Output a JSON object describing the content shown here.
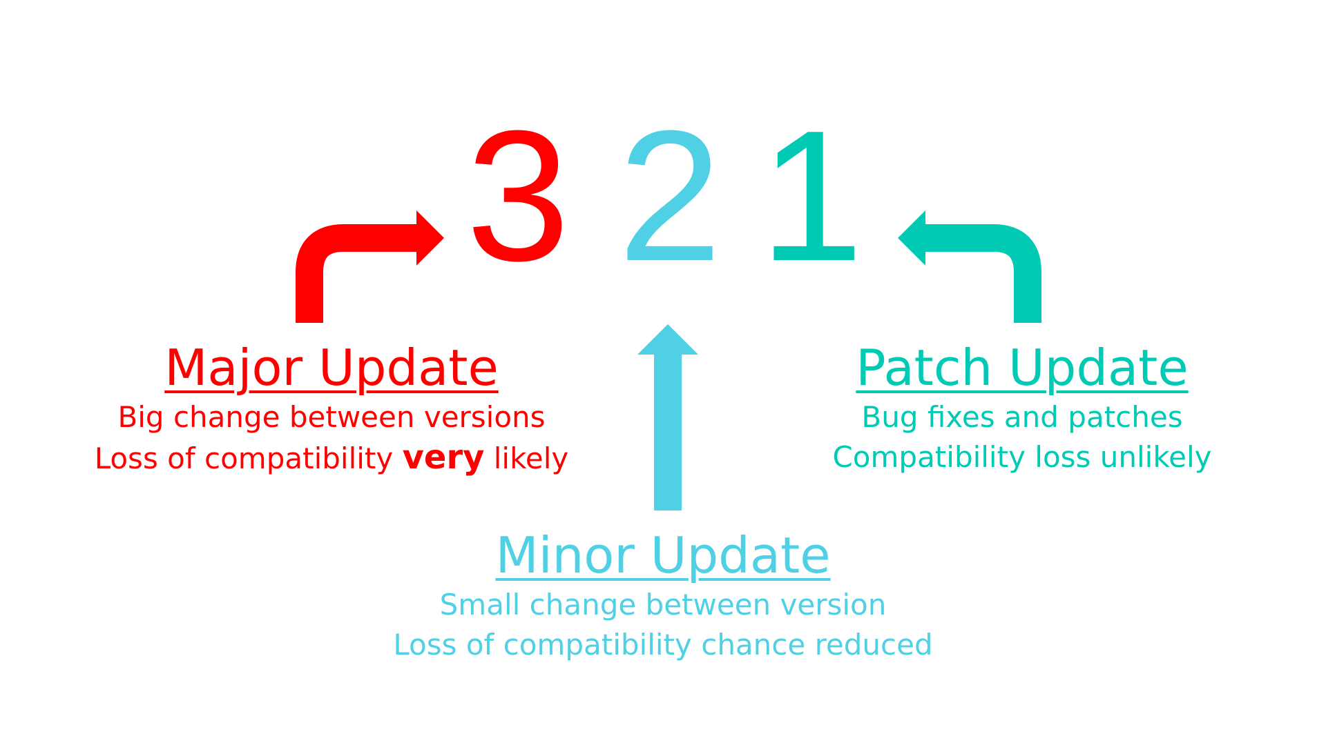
{
  "version": {
    "major_digit": "3",
    "minor_digit": "2",
    "patch_digit": "1"
  },
  "major": {
    "title": "Major Update",
    "line1": "Big change between versions",
    "line2_prefix": "Loss of compatibility ",
    "line2_emphasis": "very",
    "line2_suffix": " likely"
  },
  "minor": {
    "title": "Minor Update",
    "line1": "Small change between version",
    "line2": "Loss of compatibility chance reduced"
  },
  "patch": {
    "title": "Patch Update",
    "line1": "Bug fixes and patches",
    "line2": "Compatibility loss unlikely"
  },
  "colors": {
    "major": "#ff0000",
    "minor": "#4fd0e4",
    "patch": "#00c9b4",
    "background": "#ffffff"
  },
  "icons": {
    "major_arrow": "bent-arrow-up-right-icon",
    "minor_arrow": "arrow-up-icon",
    "patch_arrow": "bent-arrow-up-left-icon"
  }
}
